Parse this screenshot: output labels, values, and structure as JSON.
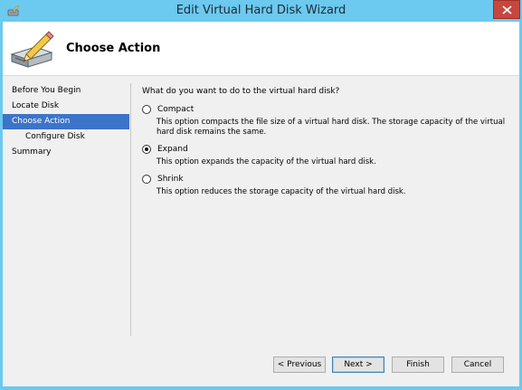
{
  "window": {
    "title": "Edit Virtual Hard Disk Wizard",
    "close_label": "×"
  },
  "header": {
    "title": "Choose Action"
  },
  "nav": {
    "items": [
      {
        "label": "Before You Begin"
      },
      {
        "label": "Locate Disk"
      },
      {
        "label": "Choose Action"
      },
      {
        "label": "Configure Disk"
      },
      {
        "label": "Summary"
      }
    ]
  },
  "content": {
    "question": "What do you want to do to the virtual hard disk?",
    "options": [
      {
        "label": "Compact",
        "selected": false,
        "description": "This option compacts the file size of a virtual hard disk. The storage capacity of the virtual hard disk remains the same."
      },
      {
        "label": "Expand",
        "selected": true,
        "description": "This option expands the capacity of the virtual hard disk."
      },
      {
        "label": "Shrink",
        "selected": false,
        "description": "This option reduces the storage capacity of the virtual hard disk."
      }
    ]
  },
  "buttons": {
    "previous": "< Previous",
    "next": "Next >",
    "finish": "Finish",
    "cancel": "Cancel"
  },
  "colors": {
    "titlebar": "#6cc9ef",
    "nav_active": "#3c74c9",
    "close_button": "#c7463e"
  }
}
